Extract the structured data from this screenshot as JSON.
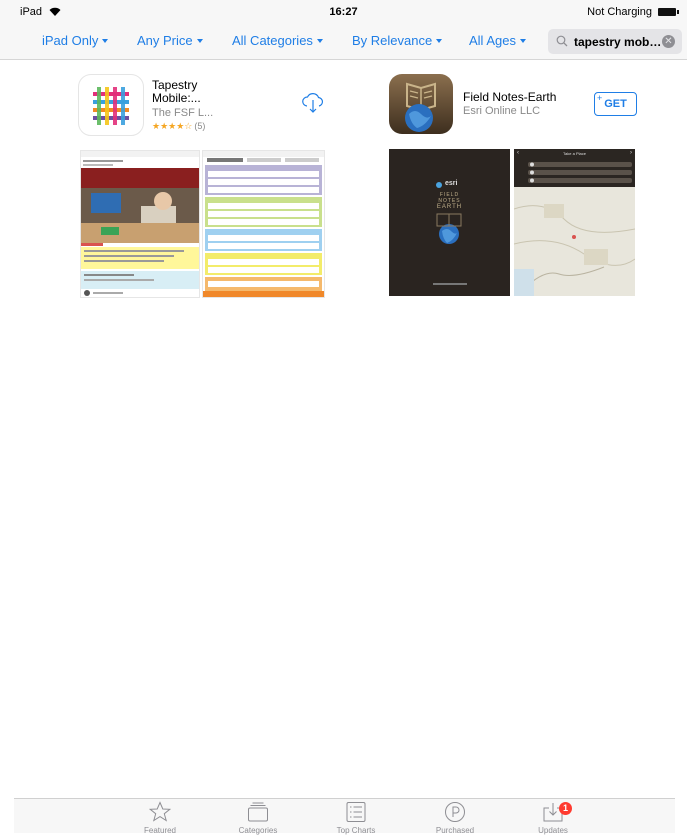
{
  "status_bar": {
    "device": "iPad",
    "time": "16:27",
    "charging": "Not Charging"
  },
  "filters": [
    {
      "label": "iPad Only"
    },
    {
      "label": "Any Price"
    },
    {
      "label": "All Categories"
    },
    {
      "label": "By Relevance"
    },
    {
      "label": "All Ages"
    }
  ],
  "search": {
    "query": "tapestry mobile"
  },
  "apps": [
    {
      "title_line1": "Tapestry",
      "title_line2": "Mobile:...",
      "developer": "The FSF L...",
      "stars": "★★★★☆",
      "rating_count": "(5)",
      "action": "download-cloud"
    },
    {
      "title_line1": "Field Notes-Earth",
      "developer": "Esri Online LLC",
      "action_label": "GET",
      "action_plus": "+"
    }
  ],
  "screenshots": {
    "field_notes_left": {
      "brand": "esri",
      "line1": "FIELD",
      "line2": "NOTES",
      "line3": "EARTH"
    },
    "field_notes_right": {
      "header": "Take a Place"
    }
  },
  "tab_bar": [
    {
      "label": "Featured",
      "icon": "star-icon"
    },
    {
      "label": "Categories",
      "icon": "categories-icon"
    },
    {
      "label": "Top Charts",
      "icon": "top-charts-icon"
    },
    {
      "label": "Purchased",
      "icon": "purchased-icon"
    },
    {
      "label": "Updates",
      "icon": "updates-icon",
      "badge": "1"
    }
  ],
  "colors": {
    "accent": "#1f7ee6",
    "tab_inactive": "#8e8e93",
    "badge": "#ff3b30",
    "star": "#f5a623"
  }
}
